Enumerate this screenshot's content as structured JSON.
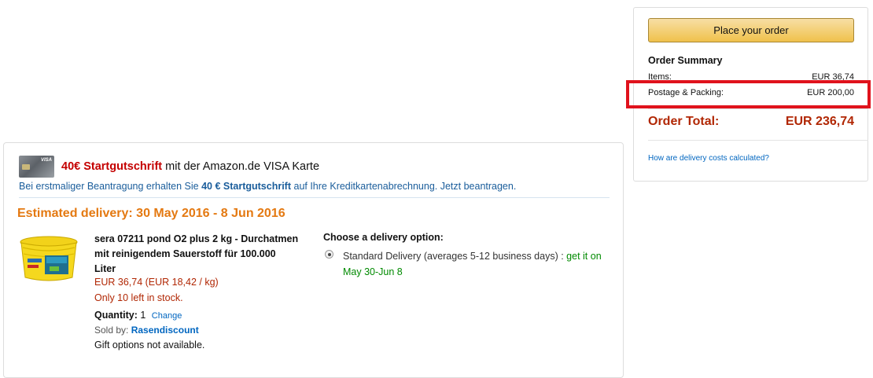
{
  "summary": {
    "place_order_label": "Place your order",
    "title": "Order Summary",
    "items_label": "Items:",
    "items_value": "EUR 36,74",
    "postage_label": "Postage & Packing:",
    "postage_value": "EUR 200,00",
    "total_label": "Order Total:",
    "total_value": "EUR 236,74",
    "delivery_link": "How are delivery costs calculated?"
  },
  "promo": {
    "card_brand": "VISA",
    "amount": "40€ Startgutschrift",
    "title_rest": " mit der Amazon.de VISA Karte",
    "sub_prefix": "Bei erstmaliger Beantragung erhalten Sie ",
    "sub_bold": "40 € Startgutschrift",
    "sub_suffix": " auf Ihre Kreditkartenabrechnung. Jetzt beantragen."
  },
  "shipment": {
    "estimated_delivery": "Estimated delivery:  30 May 2016 - 8 Jun 2016",
    "product": {
      "title": "sera 07211 pond O2 plus 2 kg - Durchatmen mit reinigendem Sauerstoff für 100.000 Liter",
      "price": "EUR 36,74",
      "unit_price": " (EUR 18,42 / kg)",
      "stock": "Only 10 left in stock.",
      "quantity_label": "Quantity:",
      "quantity_value": " 1",
      "change_label": "Change",
      "sold_by_label": "Sold by: ",
      "seller": "Rasendiscount",
      "gift": "Gift options not available."
    },
    "delivery_options": {
      "heading": "Choose a delivery option:",
      "selected_option": "Standard Delivery (averages 5-12 business days)",
      "separator": " : ",
      "eta": "get it on May 30-Jun 8"
    }
  },
  "colors": {
    "accent_orange": "#e47911",
    "price_red": "#b12704",
    "link_blue": "#0066c0",
    "highlight_red": "#e0121c",
    "button_yellow": "#f0c14b",
    "eta_green": "#008a00"
  }
}
